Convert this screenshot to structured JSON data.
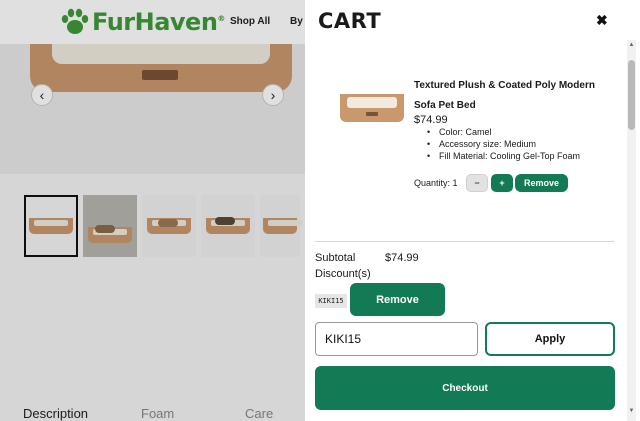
{
  "brand": {
    "name_part1": "Fur",
    "name_part2": "Haven",
    "registered": "®"
  },
  "nav": {
    "shop_all": "Shop All",
    "by": "By"
  },
  "gallery": {
    "prev_arrow": "‹",
    "next_arrow": "›"
  },
  "product_tabs": [
    "Description",
    "Foam",
    "Care"
  ],
  "cart": {
    "title": "CART",
    "close_symbol": "✖",
    "item": {
      "name": "Textured Plush & Coated Poly Modern Sofa Pet Bed",
      "price": "$74.99",
      "attributes": [
        "Color: Camel",
        "Accessory size: Medium",
        "Fill Material: Cooling Gel-Top Foam"
      ],
      "quantity_label": "Quantity: 1",
      "minus_label": "−",
      "plus_label": "+",
      "remove_label": "Remove"
    },
    "subtotal_label": "Subtotal",
    "subtotal_value": "$74.99",
    "discount_label": "Discount(s)",
    "applied_code": "KIKI15",
    "discount_remove_label": "Remove",
    "code_input_value": "KIKI15",
    "apply_label": "Apply",
    "checkout_label": "Checkout"
  },
  "colors": {
    "primary_green": "#127a55",
    "logo_green": "#3f9a3a",
    "bed_camel": "#c9986d"
  }
}
